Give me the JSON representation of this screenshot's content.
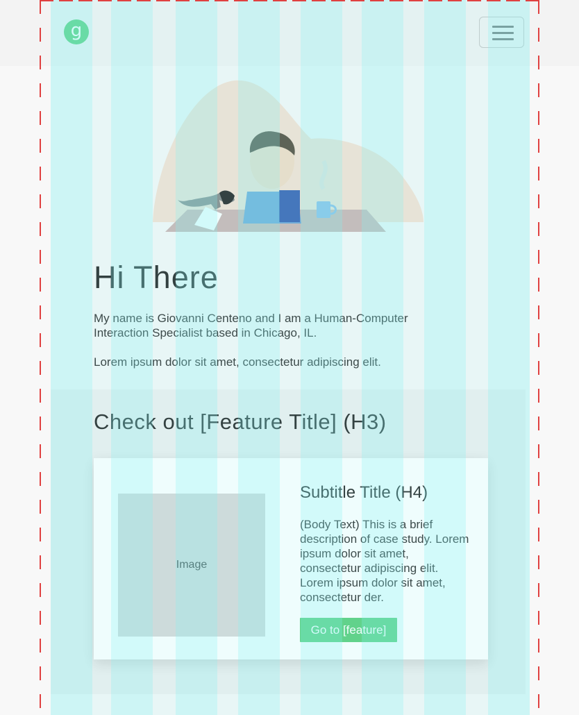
{
  "navbar": {
    "logo_letter": "g",
    "toggler_icon": "hamburger-menu-icon"
  },
  "hero": {
    "illustration": "person-at-desk-with-dog-illustration"
  },
  "intro": {
    "heading": "Hi There",
    "paragraph": "My name is Giovanni Centeno and I am a Human-Computer Interaction Specialist based in Chicago, IL.",
    "lorem": "Lorem ipsum dolor sit amet, consectetur adipiscing elit."
  },
  "feature": {
    "heading": "Check out [Feature Title] (H3)",
    "card": {
      "image_label": "Image",
      "subtitle": "Subtitle Title (H4)",
      "body": "(Body Text) This is a brief description of case study. Lorem ipsum dolor sit amet, consectetur adipiscing elit. Lorem ipsum dolor sit amet, consectetur der.",
      "cta_label": "Go to [feature]"
    }
  },
  "colors": {
    "brand_green": "#5ecf7e",
    "grid_cyan": "#7ff0f0",
    "guide_red": "#e04040"
  }
}
